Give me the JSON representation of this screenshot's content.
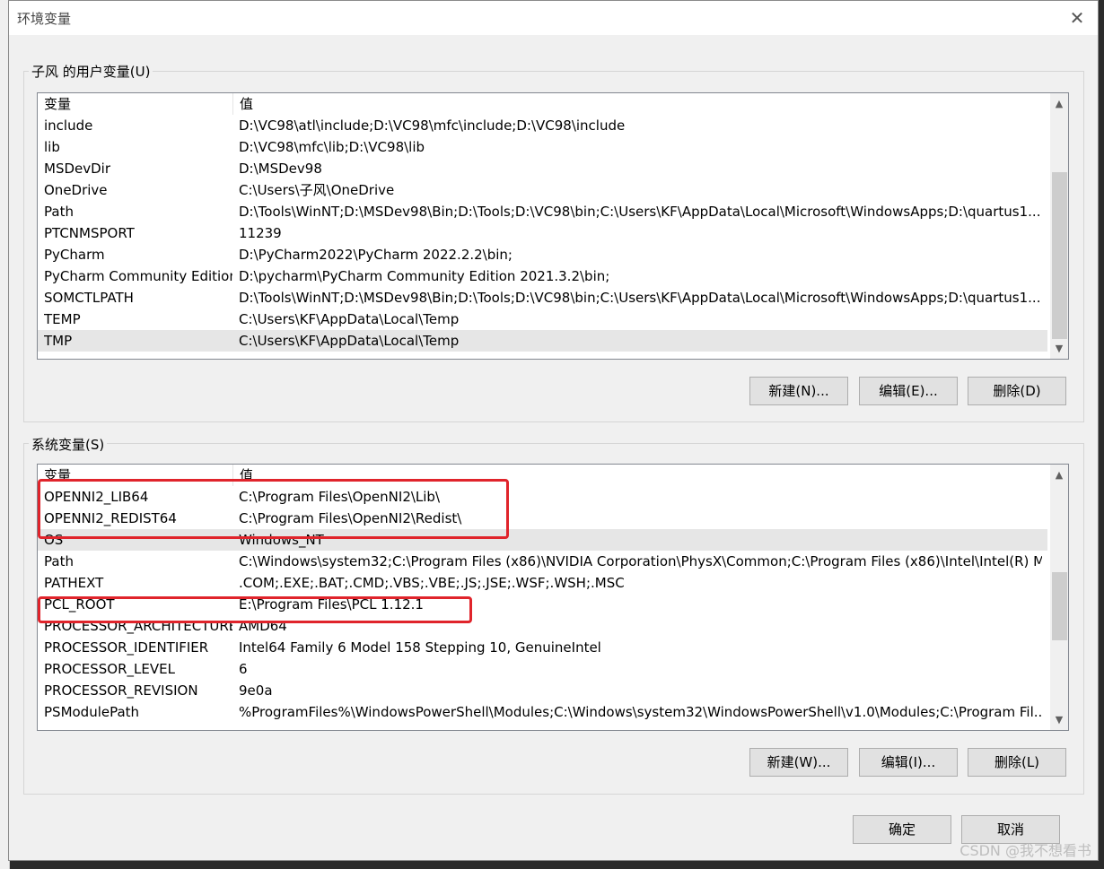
{
  "window": {
    "title": "环境变量"
  },
  "user_vars": {
    "group_label": "子风 的用户变量(U)",
    "columns": [
      "变量",
      "值"
    ],
    "rows": [
      {
        "name": "include",
        "value": "D:\\VC98\\atl\\include;D:\\VC98\\mfc\\include;D:\\VC98\\include"
      },
      {
        "name": "lib",
        "value": "D:\\VC98\\mfc\\lib;D:\\VC98\\lib"
      },
      {
        "name": "MSDevDir",
        "value": "D:\\MSDev98"
      },
      {
        "name": "OneDrive",
        "value": "C:\\Users\\子风\\OneDrive"
      },
      {
        "name": "Path",
        "value": "D:\\Tools\\WinNT;D:\\MSDev98\\Bin;D:\\Tools;D:\\VC98\\bin;C:\\Users\\KF\\AppData\\Local\\Microsoft\\WindowsApps;D:\\quartus1..."
      },
      {
        "name": "PTCNMSPORT",
        "value": "11239"
      },
      {
        "name": "PyCharm",
        "value": "D:\\PyCharm2022\\PyCharm 2022.2.2\\bin;"
      },
      {
        "name": "PyCharm Community Edition",
        "value": "D:\\pycharm\\PyCharm Community Edition 2021.3.2\\bin;"
      },
      {
        "name": "SOMCTLPATH",
        "value": "D:\\Tools\\WinNT;D:\\MSDev98\\Bin;D:\\Tools;D:\\VC98\\bin;C:\\Users\\KF\\AppData\\Local\\Microsoft\\WindowsApps;D:\\quartus1..."
      },
      {
        "name": "TEMP",
        "value": "C:\\Users\\KF\\AppData\\Local\\Temp"
      },
      {
        "name": "TMP",
        "value": "C:\\Users\\KF\\AppData\\Local\\Temp"
      }
    ],
    "selected_row": "TMP",
    "buttons": {
      "new": "新建(N)...",
      "edit": "编辑(E)...",
      "delete": "删除(D)"
    }
  },
  "system_vars": {
    "group_label": "系统变量(S)",
    "columns": [
      "变量",
      "值"
    ],
    "rows": [
      {
        "name": "OPENNI2_LIB64",
        "value": "C:\\Program Files\\OpenNI2\\Lib\\"
      },
      {
        "name": "OPENNI2_REDIST64",
        "value": "C:\\Program Files\\OpenNI2\\Redist\\"
      },
      {
        "name": "OS",
        "value": "Windows_NT"
      },
      {
        "name": "Path",
        "value": "C:\\Windows\\system32;C:\\Program Files (x86)\\NVIDIA Corporation\\PhysX\\Common;C:\\Program Files (x86)\\Intel\\Intel(R) M..."
      },
      {
        "name": "PATHEXT",
        "value": ".COM;.EXE;.BAT;.CMD;.VBS;.VBE;.JS;.JSE;.WSF;.WSH;.MSC"
      },
      {
        "name": "PCL_ROOT",
        "value": "E:\\Program Files\\PCL 1.12.1"
      },
      {
        "name": "PROCESSOR_ARCHITECTURE",
        "value": "AMD64"
      },
      {
        "name": "PROCESSOR_IDENTIFIER",
        "value": "Intel64 Family 6 Model 158 Stepping 10, GenuineIntel"
      },
      {
        "name": "PROCESSOR_LEVEL",
        "value": "6"
      },
      {
        "name": "PROCESSOR_REVISION",
        "value": "9e0a"
      },
      {
        "name": "PSModulePath",
        "value": "%ProgramFiles%\\WindowsPowerShell\\Modules;C:\\Windows\\system32\\WindowsPowerShell\\v1.0\\Modules;C:\\Program Fil..."
      }
    ],
    "selected_row": "OS",
    "buttons": {
      "new": "新建(W)...",
      "edit": "编辑(I)...",
      "delete": "删除(L)"
    }
  },
  "dialog_buttons": {
    "ok": "确定",
    "cancel": "取消"
  },
  "watermark": "CSDN @我不想看书",
  "colors": {
    "highlight": "#e0242b",
    "selected_row": "#e6e6e6"
  }
}
